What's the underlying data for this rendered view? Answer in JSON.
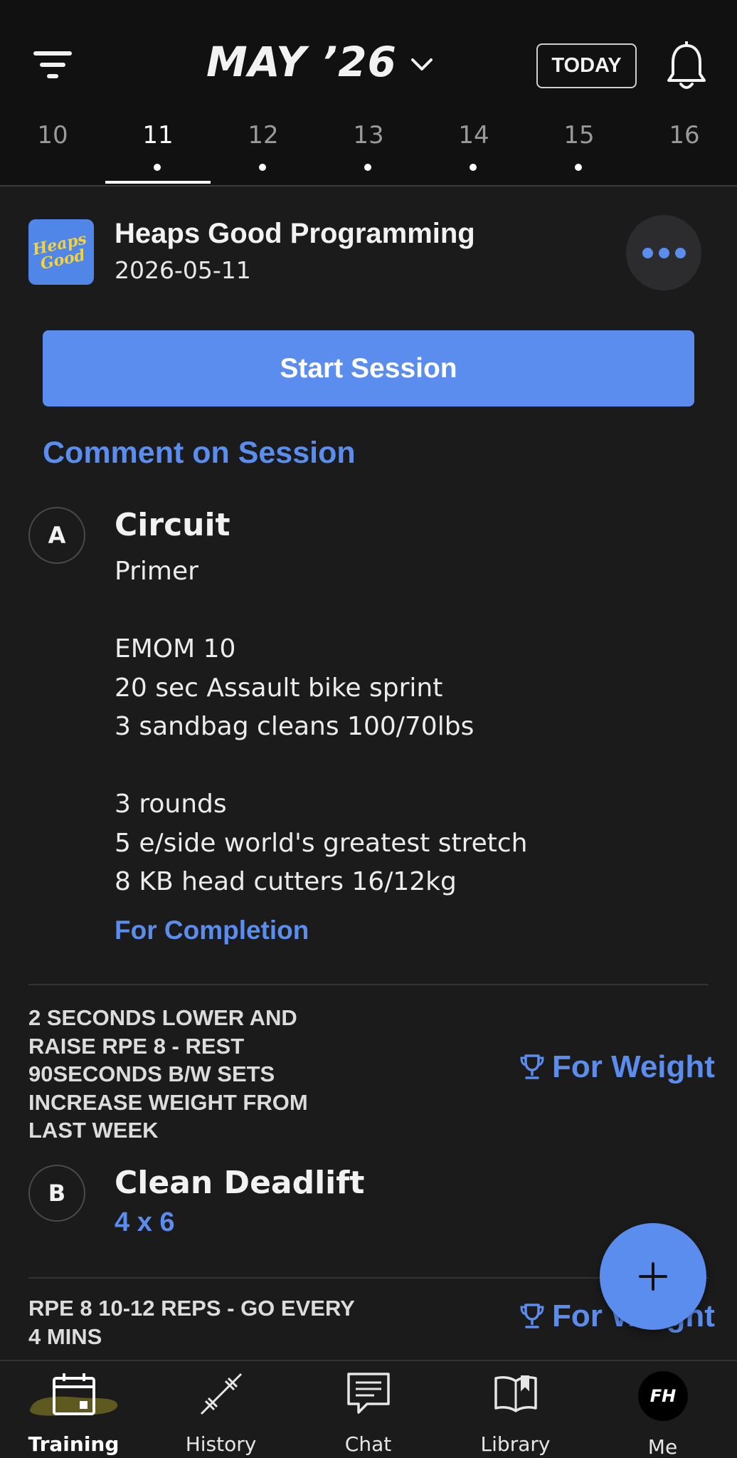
{
  "header": {
    "month": "MAY ’26",
    "today_label": "TODAY",
    "days": [
      {
        "num": "10",
        "dot": false,
        "active": false
      },
      {
        "num": "11",
        "dot": true,
        "active": true
      },
      {
        "num": "12",
        "dot": true,
        "active": false
      },
      {
        "num": "13",
        "dot": true,
        "active": false
      },
      {
        "num": "14",
        "dot": true,
        "active": false
      },
      {
        "num": "15",
        "dot": true,
        "active": false
      },
      {
        "num": "16",
        "dot": false,
        "active": false
      }
    ]
  },
  "session": {
    "logo_text": "Heaps Good",
    "program_name": "Heaps Good Programming",
    "date": "2026-05-11",
    "start_label": "Start Session",
    "comment_label": "Comment on Session"
  },
  "blocks": [
    {
      "letter": "A",
      "title": "Circuit",
      "lines": [
        "Primer",
        "",
        "EMOM 10",
        "20 sec Assault bike sprint",
        "3 sandbag cleans 100/70lbs",
        "",
        "3 rounds",
        "5 e/side world's greatest stretch",
        "8 KB head cutters 16/12kg"
      ],
      "scoring": "For Completion"
    },
    {
      "letter": "B",
      "note_lines": [
        "2 SECONDS LOWER AND",
        "RAISE RPE 8 - REST",
        "90SECONDS B/W SETS",
        "INCREASE WEIGHT FROM",
        "LAST WEEK"
      ],
      "scoring": "For Weight",
      "title": "Clean Deadlift",
      "sets": "4 x 6"
    },
    {
      "note_lines": [
        "RPE 8 10-12 REPS - GO EVERY",
        "4 MINS"
      ],
      "scoring": "For Weight"
    }
  ],
  "nav": {
    "items": [
      {
        "label": "Training",
        "icon": "calendar-icon",
        "active": true
      },
      {
        "label": "History",
        "icon": "barbell-icon",
        "active": false
      },
      {
        "label": "Chat",
        "icon": "chat-icon",
        "active": false
      },
      {
        "label": "Library",
        "icon": "book-icon",
        "active": false
      },
      {
        "label": "Me",
        "icon": "avatar",
        "active": false
      }
    ],
    "avatar_initials": "FH"
  },
  "colors": {
    "accent": "#5b8def",
    "background": "#1b1b1c",
    "header_bg": "#111112"
  }
}
